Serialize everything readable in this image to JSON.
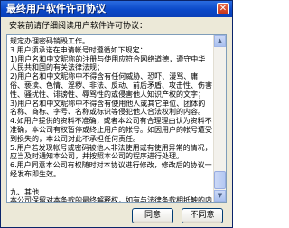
{
  "window": {
    "title": "最终用户软件许可协议",
    "close_symbol": "✕"
  },
  "prompt": "安装前请仔细阅读用户软件许可协议：",
  "license_text": "规定办理密码销毁工作。\n3.用户须承诺在申请帐号时遵循如下规定：\n1)用户名和中文昵称的注册与使用应符合网络道德，遵守中华人民共和国的有关法律法规；\n2)用户名和中文昵称中不得含有任何威胁、恐吓、漫骂、庸俗、亵渎、色情、淫秽、非法、反动、前后矛盾、攻击性、伤害性、骚扰性、诽谤性、辱骂性的或侵害他人知识产权的文字；\n3)用户名和中文昵称中不得含有使用他人或其它单位、团体的名称、商标、字号、名称或标识等侵犯他人合法权利的内容。\n4.如用户提供的资料不准确，或者本公司有合理理由认为资料不准确，本公司有权暂停或终止用户的帐号。如因用户的帐号遭受到损失的，本公司对此不承担任何责任。\n5.用户若发现帐号或密码被他人非法使用或有使用异常的情况，应当及时通知本公司，并按照本公司的程序进行处理。\n6.用户同意本公司有权随时对本协议进行修改，修改后的协议一经发布即生效。\n\n九、其他\n本公司保留对本条款的最终解释权，如有与法律条款相抵触的内容，以法律条款为准。",
  "buttons": {
    "agree": "同意",
    "disagree": "不同意"
  },
  "scrollbar": {
    "up_symbol": "▲",
    "down_symbol": "▼"
  }
}
